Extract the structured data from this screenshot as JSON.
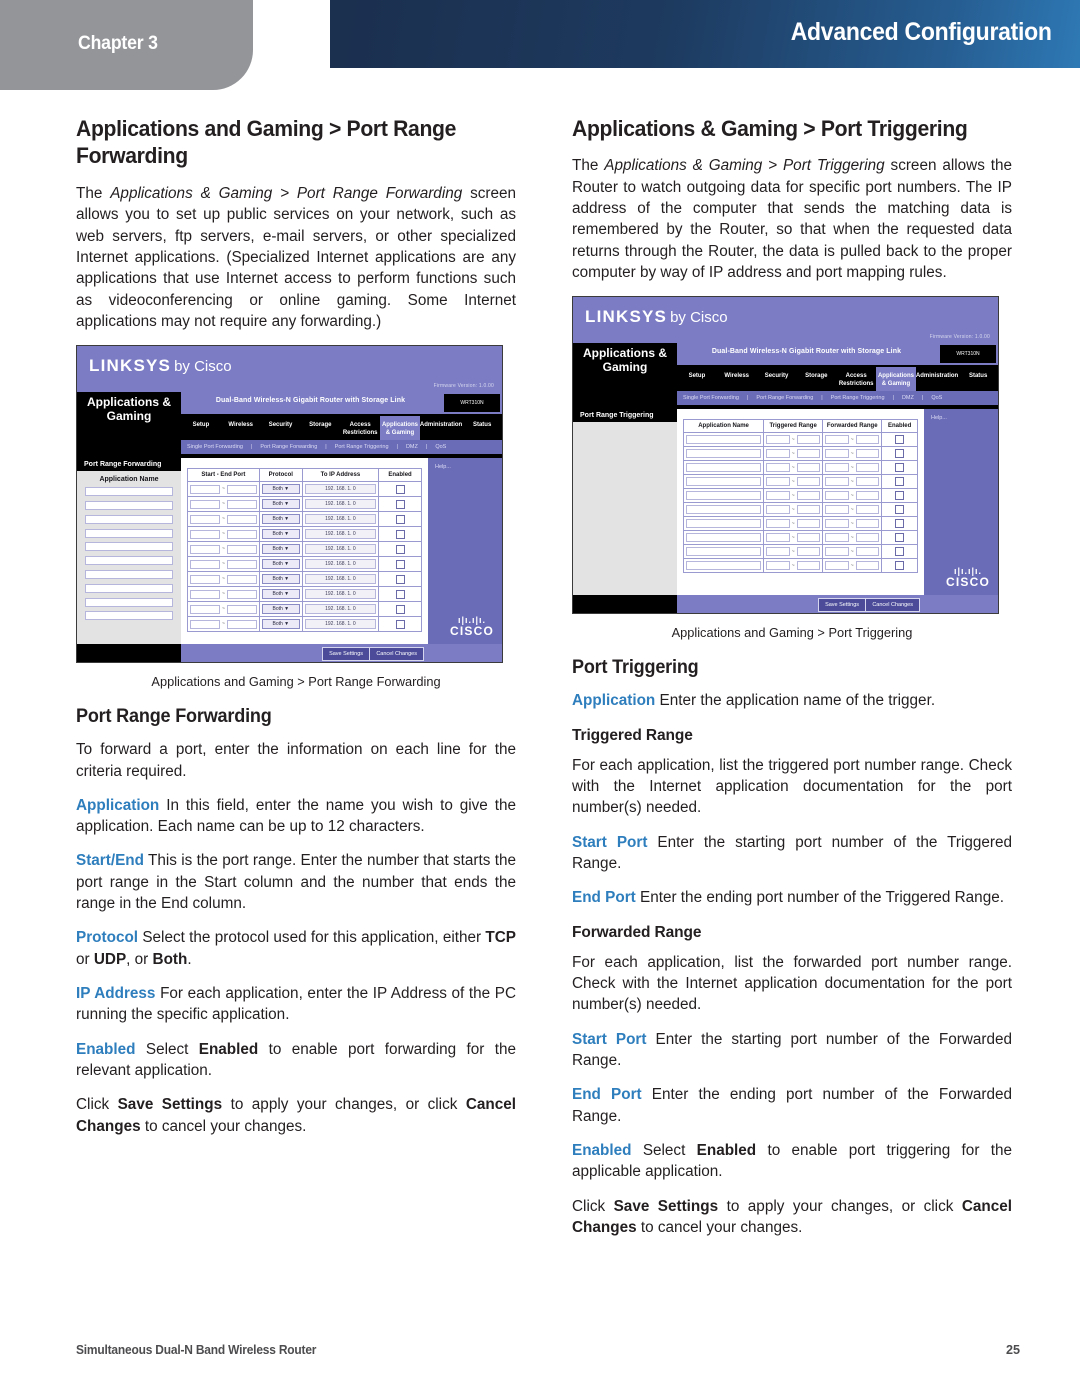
{
  "header": {
    "chapter_label": "Chapter 3",
    "banner_title": "Advanced Configuration"
  },
  "colors": {
    "accent_term": "#2e7ebd",
    "banner_dark": "#1b2f4e",
    "banner_light": "#2e79b5",
    "chapter_tab": "#949599",
    "router_purple": "#7b7cc4"
  },
  "left_column": {
    "section_title": "Applications and Gaming > Port Range Forwarding",
    "intro": {
      "p1_a": "The ",
      "p1_italic": "Applications & Gaming > Port Range Forwarding",
      "p1_b": " screen allows you to set up public services on your network, such as web servers, ftp servers, e-mail servers, or other specialized Internet applications. (Specialized Internet applications are any applications that use Internet access to perform functions such as videoconferencing or online gaming. Some Internet applications may not require any forwarding.)"
    },
    "figure_caption": "Applications and Gaming > Port Range Forwarding",
    "sub_title": "Port Range Forwarding",
    "paragraphs": [
      {
        "term": "",
        "text": "To forward a port, enter the information on each line for the criteria required."
      },
      {
        "term": "Application",
        "text": "  In this field, enter the name you wish to give the application. Each name can be up to 12 characters."
      },
      {
        "term": "Start/End",
        "text": "  This is the port range. Enter the number that starts the port range in the Start column and the number that ends the range in the End column."
      },
      {
        "term": "Protocol",
        "text": "  Select the protocol used for this application, either TCP or UDP, or Both."
      },
      {
        "term": "IP Address",
        "text": "  For each application, enter the IP Address of the PC running the specific application."
      },
      {
        "term": "Enabled",
        "text": "  Select Enabled to enable port forwarding for the relevant application."
      }
    ],
    "closing": "Click Save Settings to apply your changes, or click Cancel Changes to cancel your changes."
  },
  "right_column": {
    "section_title": "Applications & Gaming > Port Triggering",
    "intro": {
      "p1_a": "The ",
      "p1_italic": "Applications & Gaming > Port Triggering",
      "p1_b": " screen allows the Router to watch outgoing data for specific port numbers. The IP address of the computer that sends the matching data is remembered by the Router, so that when the requested data returns through the Router, the data is pulled back to the proper computer by way of IP address and port mapping rules."
    },
    "figure_caption": "Applications and Gaming > Port Triggering",
    "sub_title": "Port Triggering",
    "application_term": "Application",
    "application_text": "  Enter the application name of the trigger.",
    "triggered_range_title": "Triggered Range",
    "triggered_range_text": "For each application, list the triggered port number range. Check with the Internet application documentation for the port number(s) needed.",
    "triggered_start_term": "Start Port",
    "triggered_start_text": "  Enter the starting port number of the Triggered Range.",
    "triggered_end_term": "End Port",
    "triggered_end_text": "  Enter the ending port number of the Triggered Range.",
    "forwarded_range_title": "Forwarded Range",
    "forwarded_range_text": "For each application, list the forwarded port number range. Check with the Internet application documentation for the port number(s) needed.",
    "forwarded_start_term": "Start Port",
    "forwarded_start_text": " Enter the starting port number of the Forwarded Range.",
    "forwarded_end_term": "End Port",
    "forwarded_end_text": "  Enter the ending port number of the Forwarded Range.",
    "enabled_term": "Enabled",
    "enabled_text": "  Select Enabled to enable port triggering for the applicable application.",
    "closing": "Click Save Settings to apply your changes, or click Cancel Changes to cancel your changes."
  },
  "router_ui": {
    "logo": "LINKSYS",
    "logo_suffix": "by Cisco",
    "firmware": "Firmware Version: 1.0.00",
    "model_name": "Dual-Band Wireless-N Gigabit Router with Storage Link",
    "model_badge": "WRT310N",
    "section_name_forwarding": "Applications & Gaming",
    "section_name_triggering": "Applications & Gaming",
    "tabs": [
      "Setup",
      "Wireless",
      "Security",
      "Storage",
      "Access Restrictions",
      "Applications & Gaming",
      "Administration",
      "Status"
    ],
    "active_tab": "Applications & Gaming",
    "subtabs": [
      "Single Port Forwarding",
      "Port Range Forwarding",
      "Port Range Triggering",
      "DMZ",
      "QoS"
    ],
    "help_label": "Help...",
    "cisco_label": "CISCO",
    "save_button": "Save Settings",
    "cancel_button": "Cancel Changes",
    "forwarding": {
      "panel_title": "Port Range Forwarding",
      "left_header": "Application Name",
      "columns": [
        "Start - End Port",
        "Protocol",
        "To IP Address",
        "Enabled"
      ],
      "row_count": 10,
      "protocol_value": "Both",
      "ip_prefix": "192. 168. 1.",
      "ip_suffix": "0"
    },
    "triggering": {
      "panel_title": "Port Range Triggering",
      "columns": [
        "Application Name",
        "Triggered Range",
        "Forwarded Range",
        "Enabled"
      ],
      "row_count": 10
    }
  },
  "footer": {
    "document_title": "Simultaneous Dual-N Band Wireless Router",
    "page_number": "25"
  }
}
